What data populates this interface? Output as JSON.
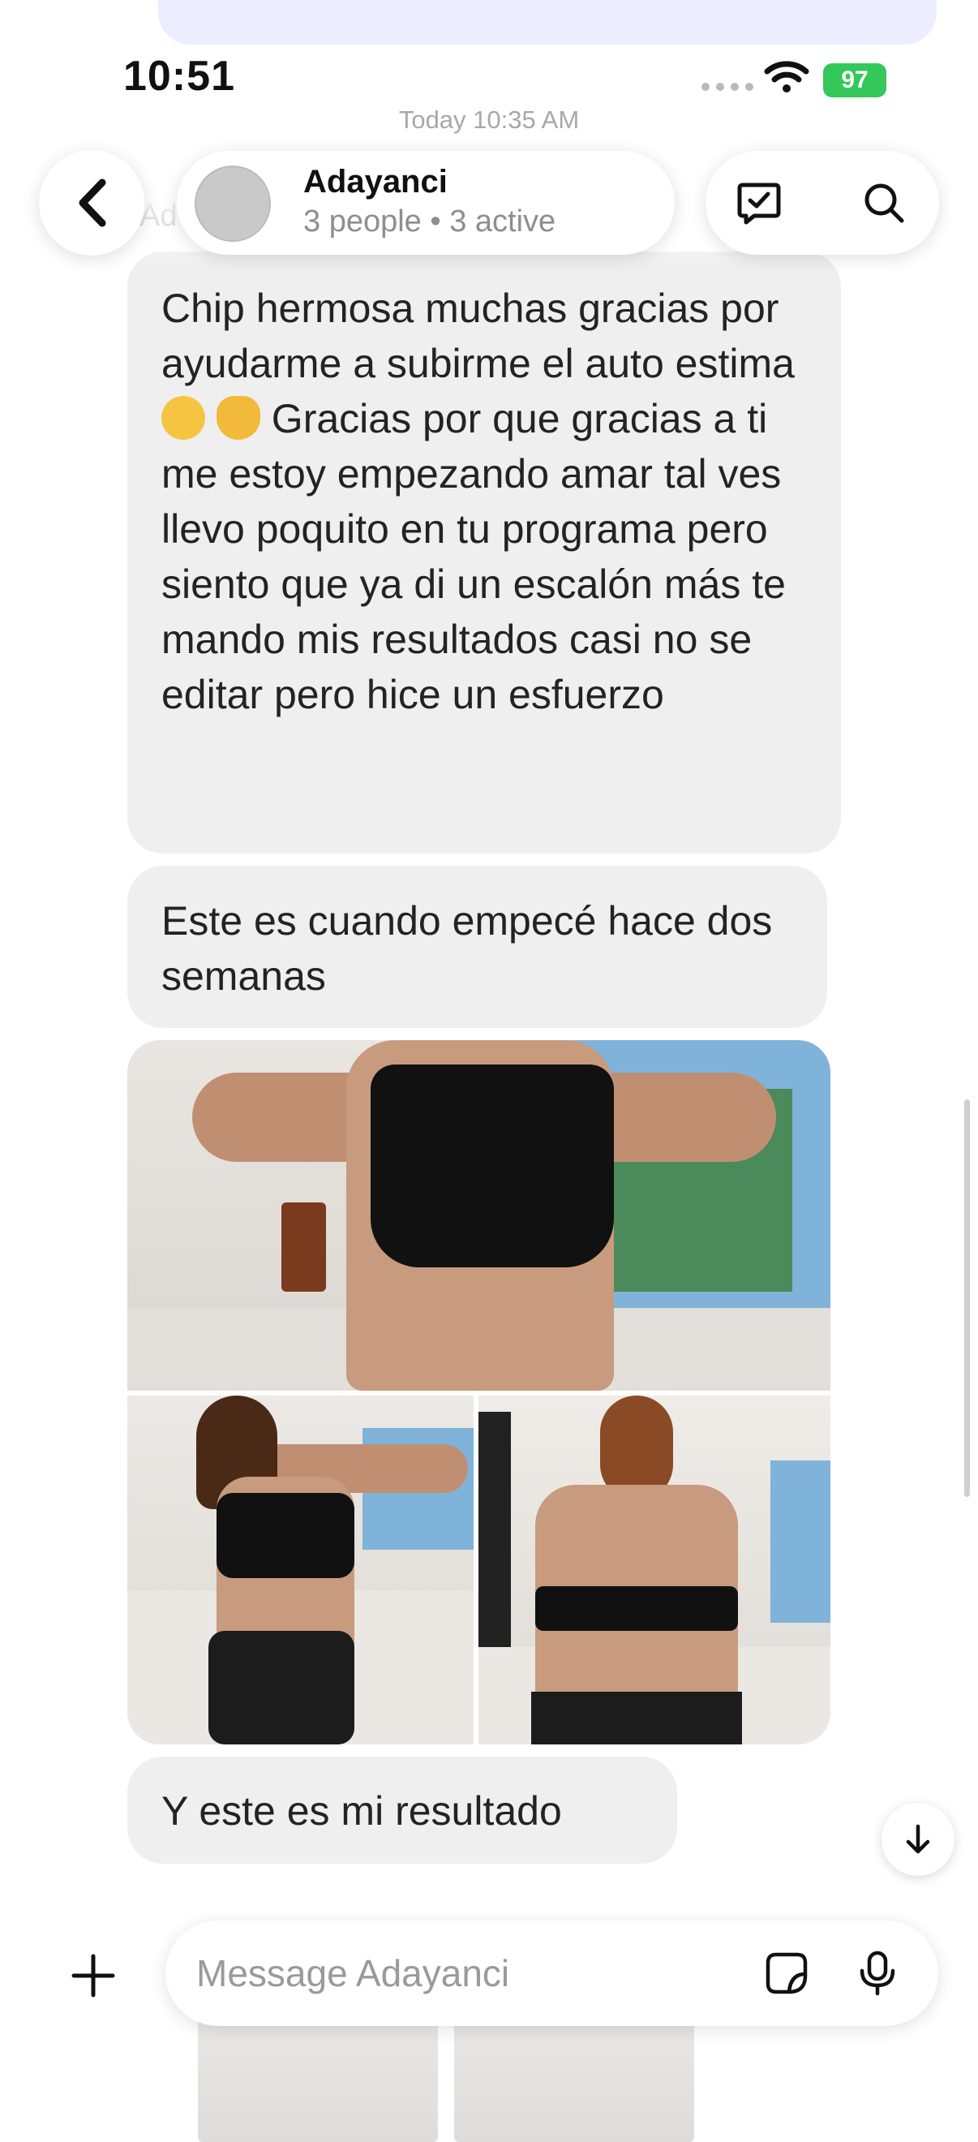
{
  "status_bar": {
    "time": "10:51",
    "battery": "97"
  },
  "thread": {
    "timestamp": "Today 10:35 AM",
    "sender_name": "Ad"
  },
  "header": {
    "title": "Adayanci",
    "subtitle": "3 people • 3 active"
  },
  "messages": {
    "m1": "Chip hermosa muchas gracias por ayudarme a subirme el auto estima ",
    "m1_emoji_1": "pleading-face-emoji",
    "m1_emoji_2": "heart-hands-emoji",
    "m1_rest": " Gracias por que gracias a ti me estoy empezando amar tal ves llevo poquito en tu programa pero siento que ya di un escalón más te mando mis resultados casi no se editar pero hice un esfuerzo",
    "m2": "Este es cuando empecé hace dos semanas",
    "m3": "Y este es mi resultado"
  },
  "composer": {
    "placeholder": "Message Adayanci"
  },
  "icons": {
    "back": "chevron-left-icon",
    "tasks": "checklist-icon",
    "search": "search-icon",
    "add": "plus-icon",
    "sticker": "sticker-icon",
    "mic": "microphone-icon",
    "scroll": "arrow-down-icon"
  },
  "colors": {
    "bubble": "#efefef",
    "battery": "#34c759",
    "accent_bubble": "#eceeff"
  }
}
